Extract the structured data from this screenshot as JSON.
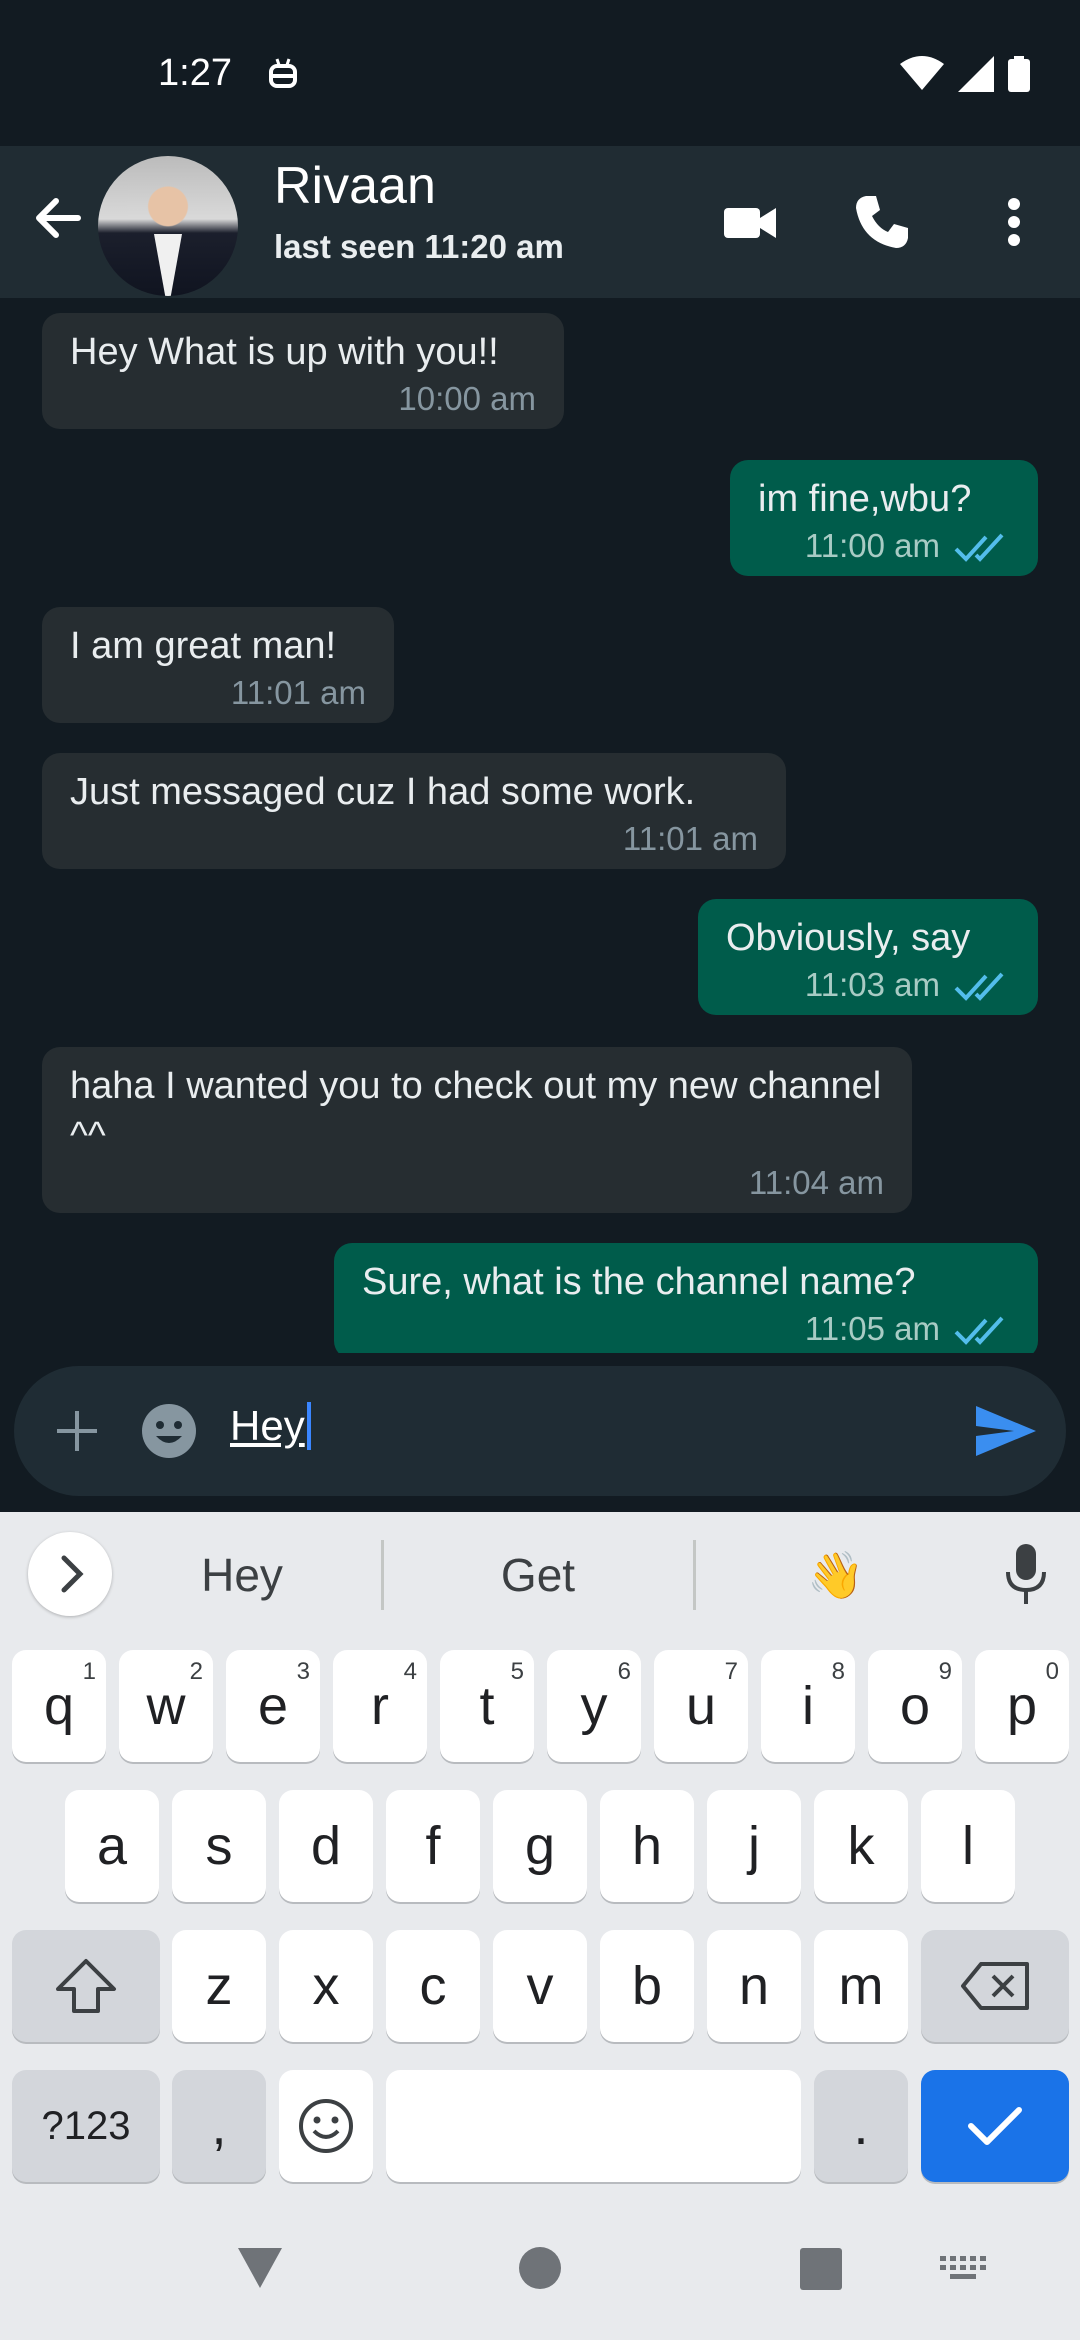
{
  "status_bar": {
    "time": "1:27"
  },
  "header": {
    "contact_name": "Rivaan",
    "last_seen": "last seen 11:20 am"
  },
  "messages": [
    {
      "direction": "incoming",
      "text": "Hey What is up with you!!",
      "time": "10:00 am"
    },
    {
      "direction": "outgoing",
      "text": "im fine,wbu?",
      "time": "11:00 am"
    },
    {
      "direction": "incoming",
      "text": "I am great man!",
      "time": "11:01 am"
    },
    {
      "direction": "incoming",
      "text": "Just messaged cuz I had some work.",
      "time": "11:01 am"
    },
    {
      "direction": "outgoing",
      "text": "Obviously, say",
      "time": "11:03 am"
    },
    {
      "direction": "incoming",
      "text": "haha I wanted you to check out my new channel ^^",
      "time": "11:04 am"
    },
    {
      "direction": "outgoing",
      "text": "Sure, what is the channel name?",
      "time": "11:05 am"
    }
  ],
  "composer": {
    "value": "Hey"
  },
  "keyboard": {
    "suggestions": [
      "Hey",
      "Get",
      "👋"
    ],
    "row1": [
      {
        "l": "q",
        "n": "1"
      },
      {
        "l": "w",
        "n": "2"
      },
      {
        "l": "e",
        "n": "3"
      },
      {
        "l": "r",
        "n": "4"
      },
      {
        "l": "t",
        "n": "5"
      },
      {
        "l": "y",
        "n": "6"
      },
      {
        "l": "u",
        "n": "7"
      },
      {
        "l": "i",
        "n": "8"
      },
      {
        "l": "o",
        "n": "9"
      },
      {
        "l": "p",
        "n": "0"
      }
    ],
    "row2": [
      "a",
      "s",
      "d",
      "f",
      "g",
      "h",
      "j",
      "k",
      "l"
    ],
    "row3": [
      "z",
      "x",
      "c",
      "v",
      "b",
      "n",
      "m"
    ],
    "symbols_label": "?123",
    "comma": ",",
    "period": "."
  },
  "colors": {
    "background": "#121b22",
    "incoming_bubble": "#262d31",
    "outgoing_bubble": "#005c4b",
    "read_ticks": "#53bdeb",
    "accent": "#1a73e8"
  }
}
